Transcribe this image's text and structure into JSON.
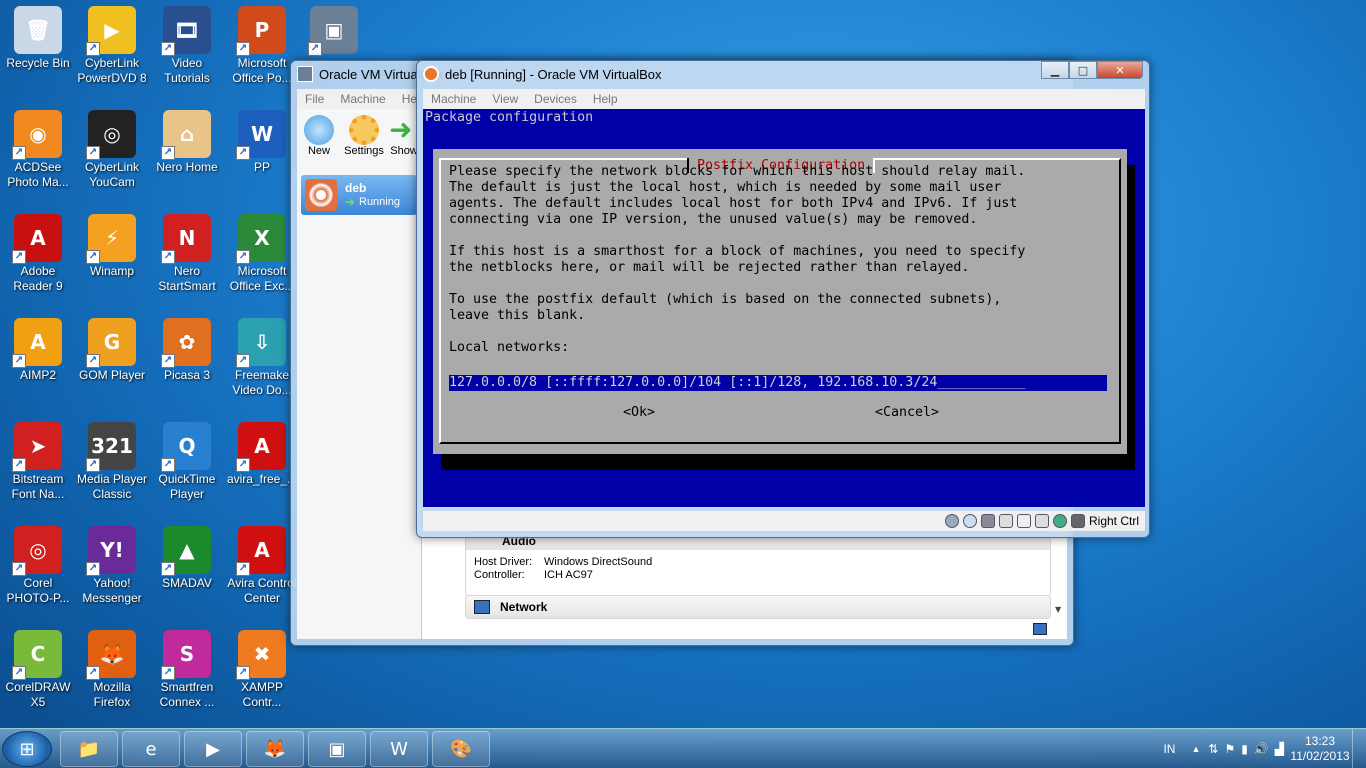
{
  "desktop_icons": [
    {
      "label": "Recycle Bin",
      "color": "#c9d7e6",
      "glyph": "🗑"
    },
    {
      "label": "CyberLink PowerDVD 8",
      "color": "#f0c020",
      "glyph": "▶"
    },
    {
      "label": "Video Tutorials",
      "color": "#2a4f8f",
      "glyph": "🎞"
    },
    {
      "label": "Microsoft Office Po...",
      "color": "#d04a1a",
      "glyph": "P"
    },
    {
      "label": "",
      "color": "#6b7f96",
      "glyph": "▣"
    },
    {
      "label": "ACDSee Photo Ma...",
      "color": "#f08a20",
      "glyph": "◉"
    },
    {
      "label": "CyberLink YouCam",
      "color": "#222222",
      "glyph": "◎"
    },
    {
      "label": "Nero Home",
      "color": "#e9c48a",
      "glyph": "⌂"
    },
    {
      "label": "PP",
      "color": "#1d5fbf",
      "glyph": "W"
    },
    {
      "label": "Adobe Reader 9",
      "color": "#c81010",
      "glyph": "A"
    },
    {
      "label": "Winamp",
      "color": "#f4a020",
      "glyph": "⚡"
    },
    {
      "label": "Nero StartSmart",
      "color": "#d02020",
      "glyph": "N"
    },
    {
      "label": "Microsoft Office Exc...",
      "color": "#2a8a3a",
      "glyph": "X"
    },
    {
      "label": "AIMP2",
      "color": "#f0a010",
      "glyph": "A"
    },
    {
      "label": "GOM Player",
      "color": "#f0a020",
      "glyph": "G"
    },
    {
      "label": "Picasa 3",
      "color": "#e07020",
      "glyph": "✿"
    },
    {
      "label": "Freemake Video Do...",
      "color": "#2aa0b0",
      "glyph": "⇩"
    },
    {
      "label": "Bitstream Font Na...",
      "color": "#d02020",
      "glyph": "➤"
    },
    {
      "label": "Media Player Classic",
      "color": "#444444",
      "glyph": "321"
    },
    {
      "label": "QuickTime Player",
      "color": "#2a80d0",
      "glyph": "Q"
    },
    {
      "label": "avira_free_...",
      "color": "#d01010",
      "glyph": "A"
    },
    {
      "label": "Corel PHOTO-P...",
      "color": "#d02020",
      "glyph": "◎"
    },
    {
      "label": "Yahoo! Messenger",
      "color": "#6a2a9a",
      "glyph": "Y!"
    },
    {
      "label": "SMADAV",
      "color": "#1a8a2a",
      "glyph": "▲"
    },
    {
      "label": "Avira Control Center",
      "color": "#d01010",
      "glyph": "A"
    },
    {
      "label": "CorelDRAW X5",
      "color": "#7aba3a",
      "glyph": "C"
    },
    {
      "label": "Mozilla Firefox",
      "color": "#e06010",
      "glyph": "🦊"
    },
    {
      "label": "Smartfren Connex ...",
      "color": "#c02a9a",
      "glyph": "S"
    },
    {
      "label": "XAMPP Contr...",
      "color": "#f07a20",
      "glyph": "✖"
    }
  ],
  "manager_window": {
    "title": "Oracle VM VirtualBox",
    "menu": [
      "File",
      "Machine",
      "He"
    ],
    "toolbar": [
      {
        "label": "New",
        "color": "#4aa0e0"
      },
      {
        "label": "Settings",
        "color": "#f0a020"
      },
      {
        "label": "Show",
        "color": "#40b040"
      }
    ],
    "vm": {
      "name": "deb",
      "state": "Running"
    },
    "details": {
      "audio_header": "Audio",
      "host_driver_label": "Host Driver:",
      "host_driver_value": "Windows DirectSound",
      "controller_label": "Controller:",
      "controller_value": "ICH AC97",
      "network_header": "Network"
    }
  },
  "vm_window": {
    "title": "deb [Running] - Oracle VM VirtualBox",
    "menu": [
      "Machine",
      "View",
      "Devices",
      "Help"
    ],
    "console_header": "Package configuration",
    "dialog": {
      "title": "Postfix Configuration",
      "text": "Please specify the network blocks for which this host should relay mail.\nThe default is just the local host, which is needed by some mail user\nagents. The default includes local host for both IPv4 and IPv6. If just\nconnecting via one IP version, the unused value(s) may be removed.\n\nIf this host is a smarthost for a block of machines, you need to specify\nthe netblocks here, or mail will be rejected rather than relayed.\n\nTo use the postfix default (which is based on the connected subnets),\nleave this blank.\n\nLocal networks:",
      "input_value": "127.0.0.0/8 [::ffff:127.0.0.0]/104 [::1]/128, 192.168.10.3/24___________",
      "ok_label": "<Ok>",
      "cancel_label": "<Cancel>"
    },
    "host_key": "Right Ctrl"
  },
  "taskbar": {
    "buttons": [
      {
        "name": "explorer",
        "glyph": "📁"
      },
      {
        "name": "ie",
        "glyph": "e"
      },
      {
        "name": "media",
        "glyph": "▶"
      },
      {
        "name": "firefox",
        "glyph": "🦊"
      },
      {
        "name": "virtualbox",
        "glyph": "▣"
      },
      {
        "name": "word",
        "glyph": "W"
      },
      {
        "name": "paint",
        "glyph": "🎨"
      }
    ],
    "language": "IN",
    "time": "13:23",
    "date": "11/02/2013"
  }
}
